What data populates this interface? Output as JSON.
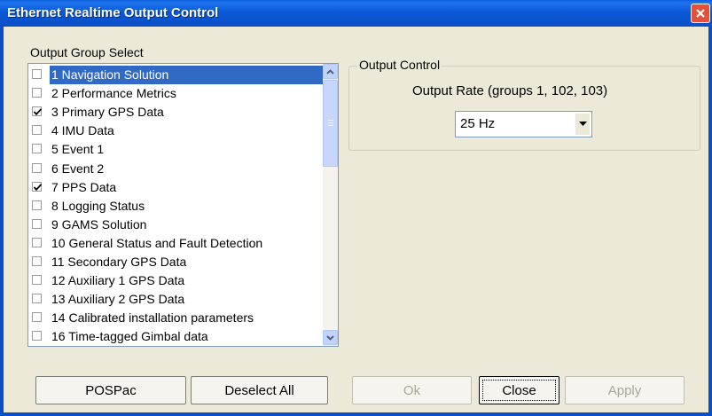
{
  "window": {
    "title": "Ethernet Realtime Output Control",
    "close_icon": "close-icon",
    "accent": "#0b4fc6"
  },
  "output_group": {
    "label": "Output Group Select",
    "items": [
      {
        "label": "1 Navigation Solution",
        "checked": false,
        "selected": true
      },
      {
        "label": "2 Performance Metrics",
        "checked": false
      },
      {
        "label": "3 Primary GPS Data",
        "checked": true
      },
      {
        "label": "4 IMU Data",
        "checked": false
      },
      {
        "label": "5 Event 1",
        "checked": false
      },
      {
        "label": "6 Event 2",
        "checked": false
      },
      {
        "label": "7 PPS Data",
        "checked": true
      },
      {
        "label": "8 Logging Status",
        "checked": false
      },
      {
        "label": "9 GAMS Solution",
        "checked": false
      },
      {
        "label": "10 General Status and Fault Detection",
        "checked": false
      },
      {
        "label": "11 Secondary GPS Data",
        "checked": false
      },
      {
        "label": "12 Auxiliary 1 GPS Data",
        "checked": false
      },
      {
        "label": "13 Auxiliary 2 GPS Data",
        "checked": false
      },
      {
        "label": "14 Calibrated installation parameters",
        "checked": false
      },
      {
        "label": "16 Time-tagged Gimbal data",
        "checked": false
      }
    ]
  },
  "output_control": {
    "legend": "Output Control",
    "rate_label": "Output Rate (groups 1, 102, 103)",
    "rate_value": "25 Hz"
  },
  "buttons": {
    "pospac": "POSPac",
    "deselect_all": "Deselect All",
    "ok": "Ok",
    "close": "Close",
    "apply": "Apply"
  }
}
